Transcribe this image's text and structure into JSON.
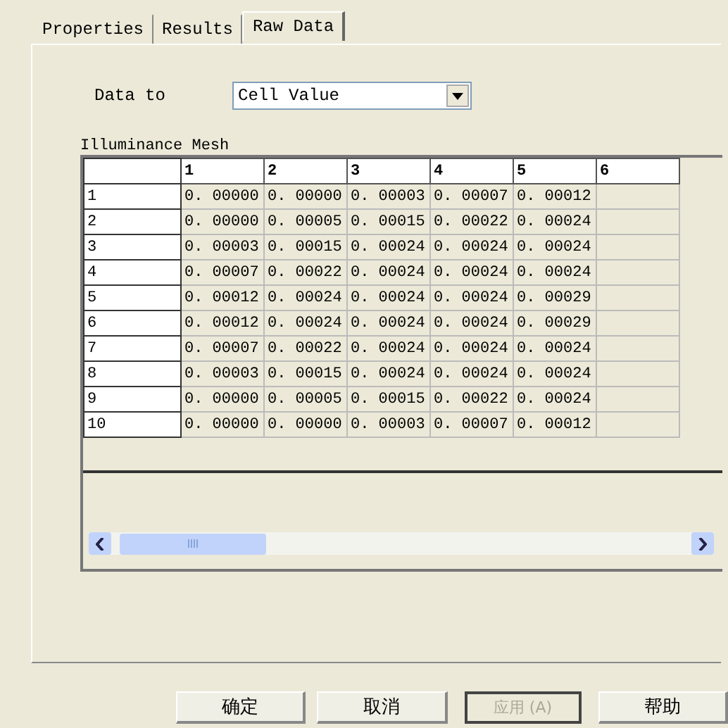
{
  "tabs": [
    {
      "label": "Properties",
      "selected": false
    },
    {
      "label": "Results",
      "selected": false
    },
    {
      "label": "Raw Data",
      "selected": true
    }
  ],
  "data_to": {
    "label": "Data to",
    "value": "Cell Value"
  },
  "grid": {
    "title": "Illuminance Mesh",
    "columns": [
      "1",
      "2",
      "3",
      "4",
      "5",
      "6"
    ],
    "rows": [
      {
        "label": "1",
        "values": [
          "0. 00000",
          "0. 00000",
          "0. 00003",
          "0. 00007",
          "0. 00012"
        ]
      },
      {
        "label": "2",
        "values": [
          "0. 00000",
          "0. 00005",
          "0. 00015",
          "0. 00022",
          "0. 00024"
        ]
      },
      {
        "label": "3",
        "values": [
          "0. 00003",
          "0. 00015",
          "0. 00024",
          "0. 00024",
          "0. 00024"
        ]
      },
      {
        "label": "4",
        "values": [
          "0. 00007",
          "0. 00022",
          "0. 00024",
          "0. 00024",
          "0. 00024"
        ]
      },
      {
        "label": "5",
        "values": [
          "0. 00012",
          "0. 00024",
          "0. 00024",
          "0. 00024",
          "0. 00029"
        ]
      },
      {
        "label": "6",
        "values": [
          "0. 00012",
          "0. 00024",
          "0. 00024",
          "0. 00024",
          "0. 00029"
        ]
      },
      {
        "label": "7",
        "values": [
          "0. 00007",
          "0. 00022",
          "0. 00024",
          "0. 00024",
          "0. 00024"
        ]
      },
      {
        "label": "8",
        "values": [
          "0. 00003",
          "0. 00015",
          "0. 00024",
          "0. 00024",
          "0. 00024"
        ]
      },
      {
        "label": "9",
        "values": [
          "0. 00000",
          "0. 00005",
          "0. 00015",
          "0. 00022",
          "0. 00024"
        ]
      },
      {
        "label": "10",
        "values": [
          "0. 00000",
          "0. 00000",
          "0. 00003",
          "0. 00007",
          "0. 00012"
        ]
      }
    ]
  },
  "buttons": [
    {
      "label": "确定",
      "disabled": false
    },
    {
      "label": "取消",
      "disabled": false
    },
    {
      "label": "应用 (A)",
      "disabled": true
    },
    {
      "label": "帮助",
      "disabled": false
    }
  ]
}
